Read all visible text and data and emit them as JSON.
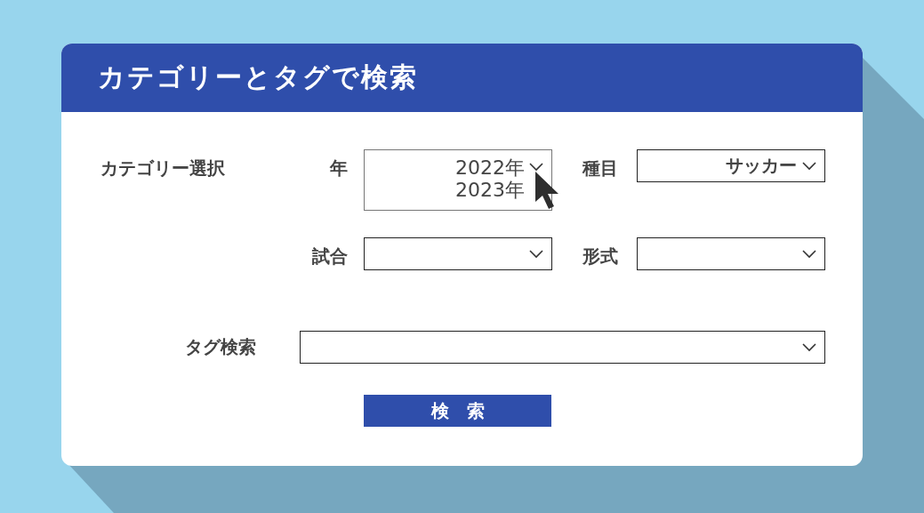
{
  "title": "カテゴリーとタグで検索",
  "category": {
    "label": "カテゴリー選択",
    "fields": [
      {
        "label": "年",
        "kind": "list",
        "options": [
          "2022年",
          "2023年"
        ]
      },
      {
        "label": "種目",
        "kind": "select",
        "value": "サッカー"
      },
      {
        "label": "試合",
        "kind": "select"
      },
      {
        "label": "形式",
        "kind": "select"
      }
    ]
  },
  "tag_search": {
    "label": "タグ検索"
  },
  "search_button": "検索"
}
